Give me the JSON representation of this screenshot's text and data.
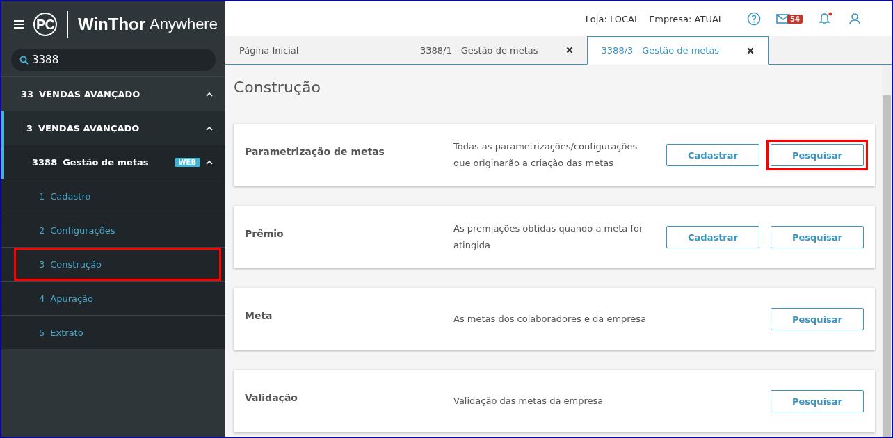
{
  "sidebar": {
    "logo_mark": "PC",
    "brand_bold": "WinThor",
    "brand_light": "Anywhere",
    "search": {
      "value": "3388"
    },
    "tree": [
      {
        "code": "33",
        "label": "VENDAS AVANÇADO",
        "expanded": true,
        "children": [
          {
            "code": "3",
            "label": "VENDAS AVANÇADO",
            "expanded": true,
            "children": [
              {
                "code": "3388",
                "label": "Gestão de metas",
                "badge": "WEB",
                "expanded": true,
                "children": [
                  {
                    "code": "1",
                    "label": "Cadastro",
                    "highlighted": false
                  },
                  {
                    "code": "2",
                    "label": "Configurações",
                    "highlighted": false
                  },
                  {
                    "code": "3",
                    "label": "Construção",
                    "highlighted": true
                  },
                  {
                    "code": "4",
                    "label": "Apuração",
                    "highlighted": false
                  },
                  {
                    "code": "5",
                    "label": "Extrato",
                    "highlighted": false
                  }
                ]
              }
            ]
          }
        ]
      }
    ]
  },
  "header": {
    "loja": "Loja: LOCAL",
    "empresa": "Empresa: ATUAL",
    "mail_count": "54",
    "notification_dot": true
  },
  "tabs": [
    {
      "label": "Página Inicial",
      "closable": false,
      "selected": false
    },
    {
      "label": "3388/1 - Gestão de metas",
      "closable": true,
      "selected": false
    },
    {
      "label": "3388/3 - Gestão de metas",
      "closable": true,
      "selected": true
    }
  ],
  "page_title": "Construção",
  "cards": [
    {
      "title": "Parametrização de metas",
      "description": "Todas as parametrizações/configurações que originarão a criação das metas",
      "buttons": [
        {
          "label": "Cadastrar",
          "highlighted": false
        },
        {
          "label": "Pesquisar",
          "highlighted": true
        }
      ]
    },
    {
      "title": "Prêmio",
      "description": "As premiações obtidas quando a meta for atingida",
      "buttons": [
        {
          "label": "Cadastrar",
          "highlighted": false
        },
        {
          "label": "Pesquisar",
          "highlighted": false
        }
      ]
    },
    {
      "title": "Meta",
      "description": "As metas dos colaboradores e da empresa",
      "buttons": [
        {
          "label": "Pesquisar",
          "highlighted": false
        }
      ]
    },
    {
      "title": "Validação",
      "description": "Validação das metas da empresa",
      "buttons": [
        {
          "label": "Pesquisar",
          "highlighted": false
        }
      ]
    }
  ]
}
